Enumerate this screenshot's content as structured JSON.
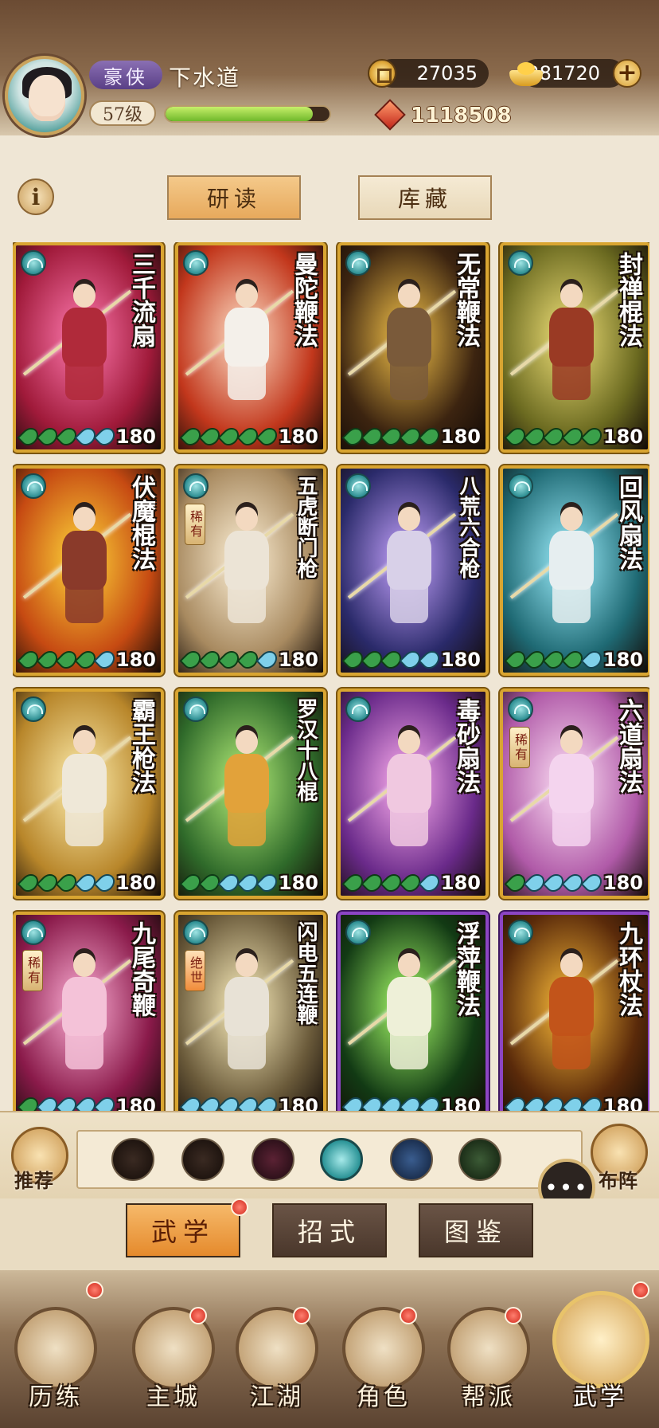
{
  "player": {
    "rank": "豪侠",
    "name": "下水道",
    "level": "57级",
    "exp_progress": 0.9,
    "copper": "27035",
    "ingot": "281720",
    "power": "1118508"
  },
  "toolbar": {
    "info": "i",
    "tab_study": "研读",
    "tab_collection": "库藏"
  },
  "cards": [
    {
      "title": "三千流扇",
      "power": "180",
      "stars": [
        "g",
        "g",
        "g",
        "b",
        "b"
      ],
      "bg": "#a01a3a",
      "accent": "#ff7ab0",
      "outfit": "#b02a3a",
      "rare": ""
    },
    {
      "title": "曼陀鞭法",
      "power": "180",
      "stars": [
        "g",
        "g",
        "g",
        "g",
        "g"
      ],
      "bg": "#c2371c",
      "accent": "#ffe1c8",
      "outfit": "#f4f0ea",
      "rare": ""
    },
    {
      "title": "无常鞭法",
      "power": "180",
      "stars": [
        "g",
        "g",
        "g",
        "g",
        "g"
      ],
      "bg": "#3c2410",
      "accent": "#f6c44a",
      "outfit": "#7a5a3a",
      "rare": ""
    },
    {
      "title": "封禅棍法",
      "power": "180",
      "stars": [
        "g",
        "g",
        "g",
        "g",
        "g"
      ],
      "bg": "#6b6a20",
      "accent": "#f2e27a",
      "outfit": "#9a3a24",
      "rare": ""
    },
    {
      "title": "伏魔棍法",
      "power": "180",
      "stars": [
        "g",
        "g",
        "g",
        "g",
        "b"
      ],
      "bg": "#c64a12",
      "accent": "#ffd83a",
      "outfit": "#8a3a2a",
      "rare": ""
    },
    {
      "title": "五虎断门枪",
      "power": "180",
      "stars": [
        "g",
        "g",
        "g",
        "g",
        "b"
      ],
      "bg": "#a88a60",
      "accent": "#fff2d8",
      "outfit": "#ece4d6",
      "rare": "稀有"
    },
    {
      "title": "八荒六合枪",
      "power": "180",
      "stars": [
        "g",
        "g",
        "g",
        "b",
        "b"
      ],
      "bg": "#2a2a6a",
      "accent": "#c7a4ff",
      "outfit": "#d8d0e8",
      "rare": ""
    },
    {
      "title": "回风扇法",
      "power": "180",
      "stars": [
        "g",
        "g",
        "g",
        "g",
        "b"
      ],
      "bg": "#1f6a74",
      "accent": "#9ff0ff",
      "outfit": "#e6eef0",
      "rare": ""
    },
    {
      "title": "霸王枪法",
      "power": "180",
      "stars": [
        "g",
        "g",
        "g",
        "b",
        "b"
      ],
      "bg": "#b8862a",
      "accent": "#fff0b0",
      "outfit": "#efe8d8",
      "rare": ""
    },
    {
      "title": "罗汉十八棍",
      "power": "180",
      "stars": [
        "g",
        "g",
        "b",
        "b",
        "b"
      ],
      "bg": "#2f6a2a",
      "accent": "#b6f07a",
      "outfit": "#e2a23a",
      "rare": ""
    },
    {
      "title": "毒砂扇法",
      "power": "180",
      "stars": [
        "g",
        "g",
        "g",
        "g",
        "b"
      ],
      "bg": "#6a2a8a",
      "accent": "#ffb0f0",
      "outfit": "#f0c8e0",
      "rare": ""
    },
    {
      "title": "六道扇法",
      "power": "180",
      "stars": [
        "g",
        "b",
        "b",
        "b",
        "b"
      ],
      "bg": "#b05aa8",
      "accent": "#ffe2f6",
      "outfit": "#f4d4ee",
      "rare": "稀有"
    },
    {
      "title": "九尾奇鞭",
      "power": "180",
      "stars": [
        "g",
        "b",
        "b",
        "b",
        "b"
      ],
      "bg": "#8a1a4a",
      "accent": "#ffb2d8",
      "outfit": "#f4c2d8",
      "rare": "稀有"
    },
    {
      "title": "闪电五连鞭",
      "power": "180",
      "stars": [
        "b",
        "b",
        "b",
        "b",
        "b"
      ],
      "bg": "#6a5a3a",
      "accent": "#fff2c0",
      "outfit": "#e8e2d6",
      "rare": "绝世"
    },
    {
      "title": "浮萍鞭法",
      "power": "180",
      "stars": [
        "b",
        "b",
        "b",
        "b",
        "b"
      ],
      "bg": "#123a14",
      "accent": "#a8ff6a",
      "outfit": "#eef0d8",
      "rare": "",
      "frame": "purple"
    },
    {
      "title": "九环杖法",
      "power": "180",
      "stars": [
        "b",
        "b",
        "b",
        "b",
        "b"
      ],
      "bg": "#5a2a0a",
      "accent": "#ffbf3a",
      "outfit": "#c2541a",
      "rare": "",
      "frame": "purple"
    }
  ],
  "filterbar": {
    "recommend": "推荐",
    "formation": "布阵",
    "chat_icon": "•••",
    "icons": [
      "sword-school-icon",
      "spear-school-icon",
      "palm-school-icon",
      "fan-school-icon",
      "taiji-school-icon",
      "leaf-school-icon"
    ]
  },
  "section_tabs": [
    "武学",
    "招式",
    "图鉴"
  ],
  "bottom_nav": [
    "历练",
    "主城",
    "江湖",
    "角色",
    "帮派",
    "武学"
  ],
  "colors": {
    "gold_frame": "#d9a531",
    "purple_frame": "#8c45c4",
    "active_tab": "#e7a95c"
  }
}
